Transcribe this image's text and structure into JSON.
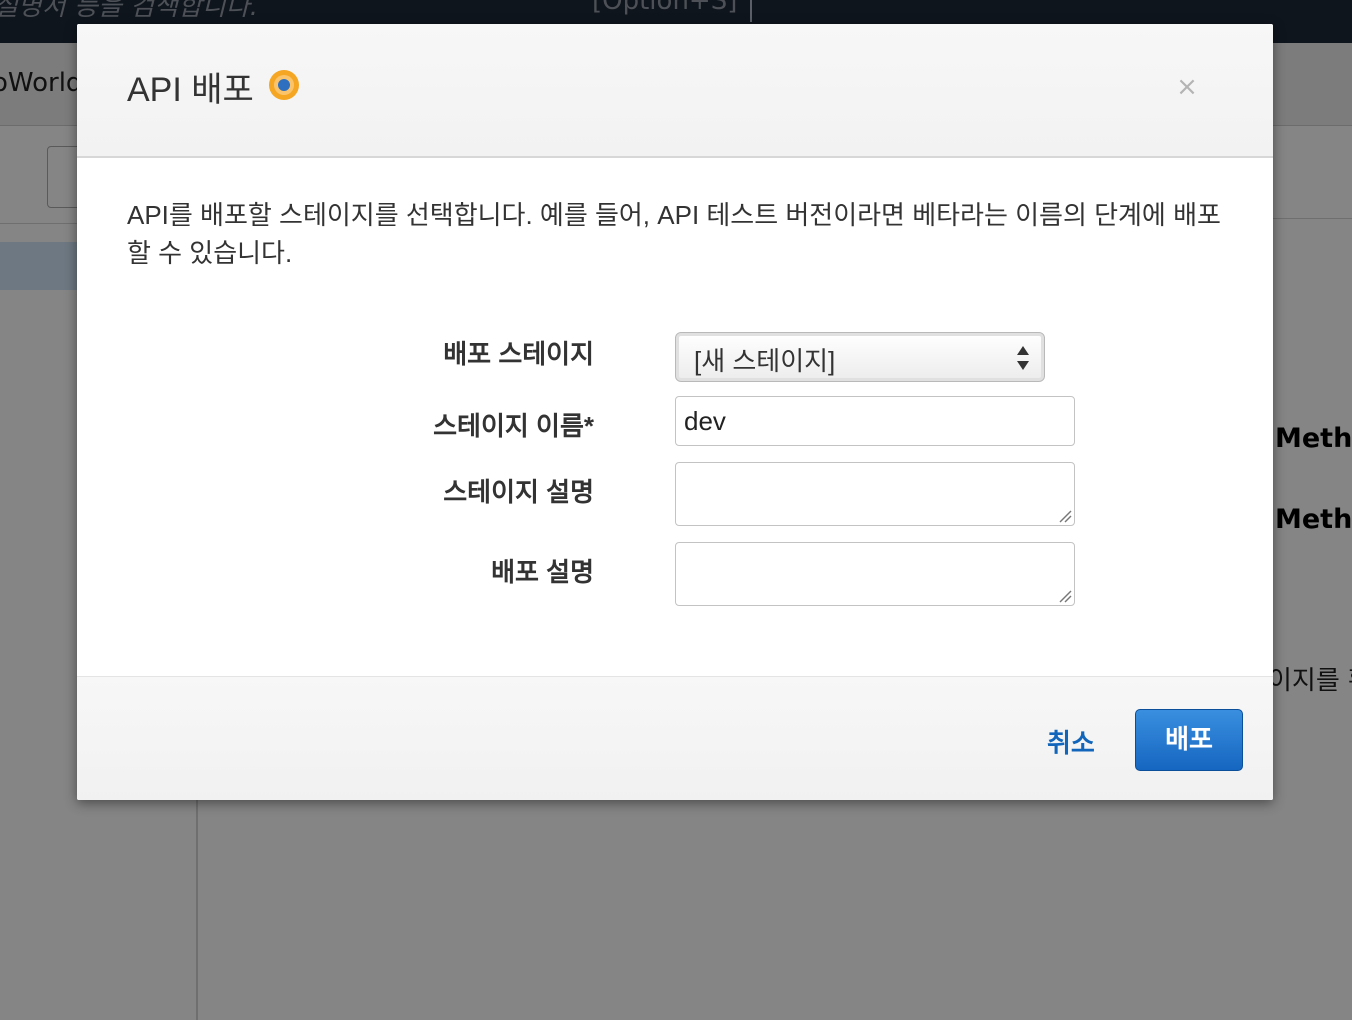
{
  "background": {
    "search_hint": "설명서 등을 검색합니다.",
    "search_shortcut": "[Option+S]",
    "api_name": "oWorld",
    "method_label_1": "Metho",
    "method_label_2": "Metho",
    "stage_text": "이지를 확"
  },
  "modal": {
    "title": "API 배포",
    "close_label": "×",
    "intro_text": "API를 배포할 스테이지를 선택합니다. 예를 들어, API 테스트 버전이라면 베타라는 이름의 단계에 배포할 수 있습니다.",
    "form": {
      "deployment_stage_label": "배포 스테이지",
      "deployment_stage_value": "[새 스테이지]",
      "stage_name_label": "스테이지 이름*",
      "stage_name_value": "dev",
      "stage_description_label": "스테이지 설명",
      "deployment_description_label": "배포 설명"
    },
    "footer": {
      "cancel_label": "취소",
      "deploy_label": "배포"
    }
  },
  "colors": {
    "accent": "#1566c0",
    "link": "#1166bb",
    "help_icon_outer": "#f5a623",
    "help_icon_inner": "#2f6fc0"
  },
  "icons": {
    "help": "info-help-icon",
    "close": "close-icon",
    "select": "select-arrows-icon",
    "resize": "resize-handle-icon"
  }
}
